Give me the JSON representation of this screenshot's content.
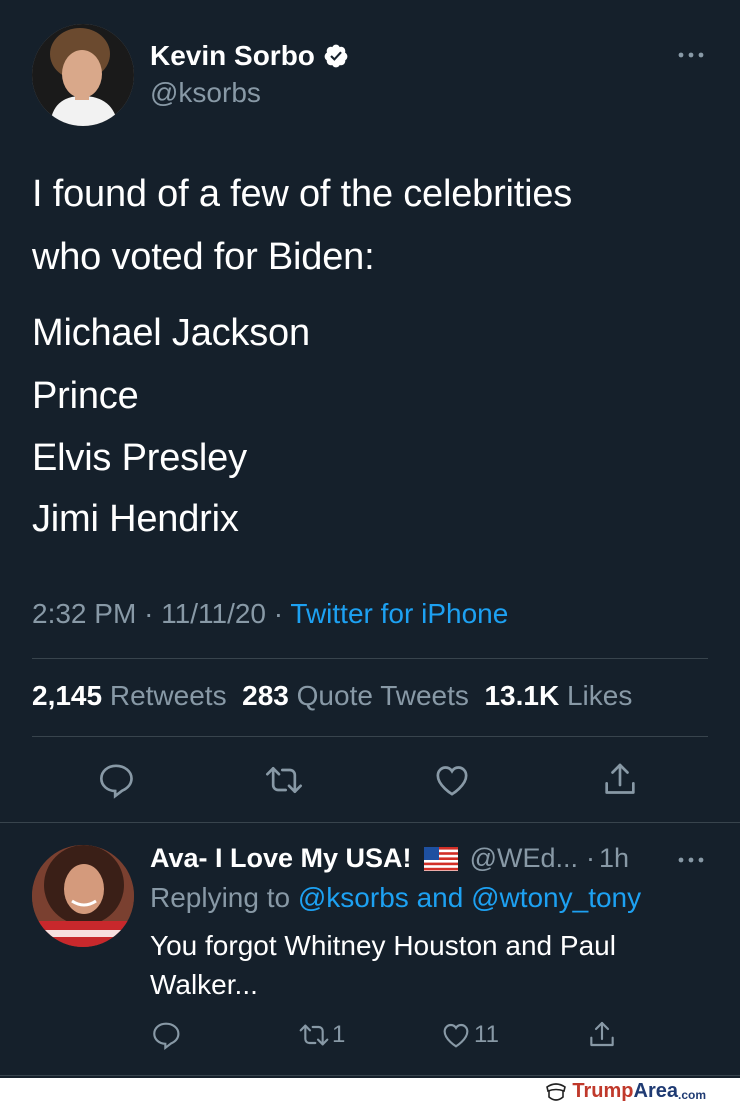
{
  "tweet": {
    "author_name": "Kevin Sorbo",
    "author_handle": "@ksorbs",
    "text_lines": [
      "I found of a few of the celebrities",
      "who voted for Biden:"
    ],
    "list_lines": [
      "Michael Jackson",
      "Prince",
      "Elvis Presley",
      "Jimi Hendrix"
    ],
    "time": "2:32 PM",
    "date": "11/11/20",
    "source": "Twitter for iPhone",
    "retweets": "2,145",
    "retweets_label": "Retweets",
    "quotes": "283",
    "quotes_label": "Quote Tweets",
    "likes": "13.1K",
    "likes_label": "Likes"
  },
  "reply": {
    "author_name": "Ava- I Love My USA!",
    "author_handle": "@WEd...",
    "age": "1h",
    "replying_prefix": "Replying to",
    "mention_1": "@ksorbs",
    "mention_joiner": "and",
    "mention_2": "@wtony_tony",
    "text_lines": [
      "You forgot Whitney Houston and Paul",
      "Walker..."
    ],
    "retweet_count": "1",
    "like_count": "11"
  },
  "footer": {
    "brand_1": "Trump",
    "brand_2": "Area",
    "brand_3": ".com"
  },
  "colors": {
    "background": "#15202b",
    "accent": "#1da1f2",
    "muted": "#8899a6",
    "divider": "#38444d"
  },
  "icons": [
    "verified-badge-icon",
    "more-options-icon",
    "reply-icon",
    "retweet-icon",
    "like-icon",
    "share-icon",
    "us-flag-icon"
  ]
}
